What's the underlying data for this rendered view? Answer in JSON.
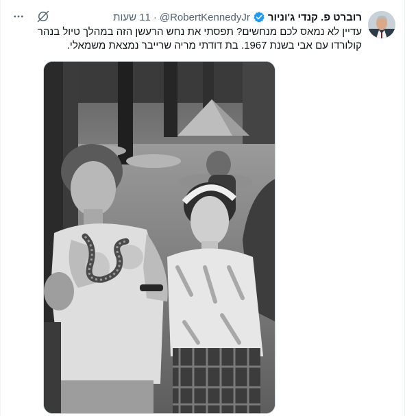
{
  "author": {
    "display_name": "רוברט פ. קנדי ג'וניור",
    "handle": "@RobertKennedyJr",
    "separator": "·",
    "time": "11 שעות",
    "verified_color": "#1d9bf0",
    "avatar_icon": "avatar-portrait"
  },
  "actions": {
    "grok_icon": "grok-icon",
    "more_icon": "more-dots-icon"
  },
  "tweet": {
    "line1": "עדיין לא נמאס לכם מנחשים? תפסתי את נחש הרעשן הזה במהלך טיול בנהר",
    "line2": "קולורדו עם אבי בשנת 1967. בת דודתי מריה שרייבר נמצאת משמאלי."
  },
  "media": {
    "description_icon": "bw-photo-children-with-snake"
  }
}
